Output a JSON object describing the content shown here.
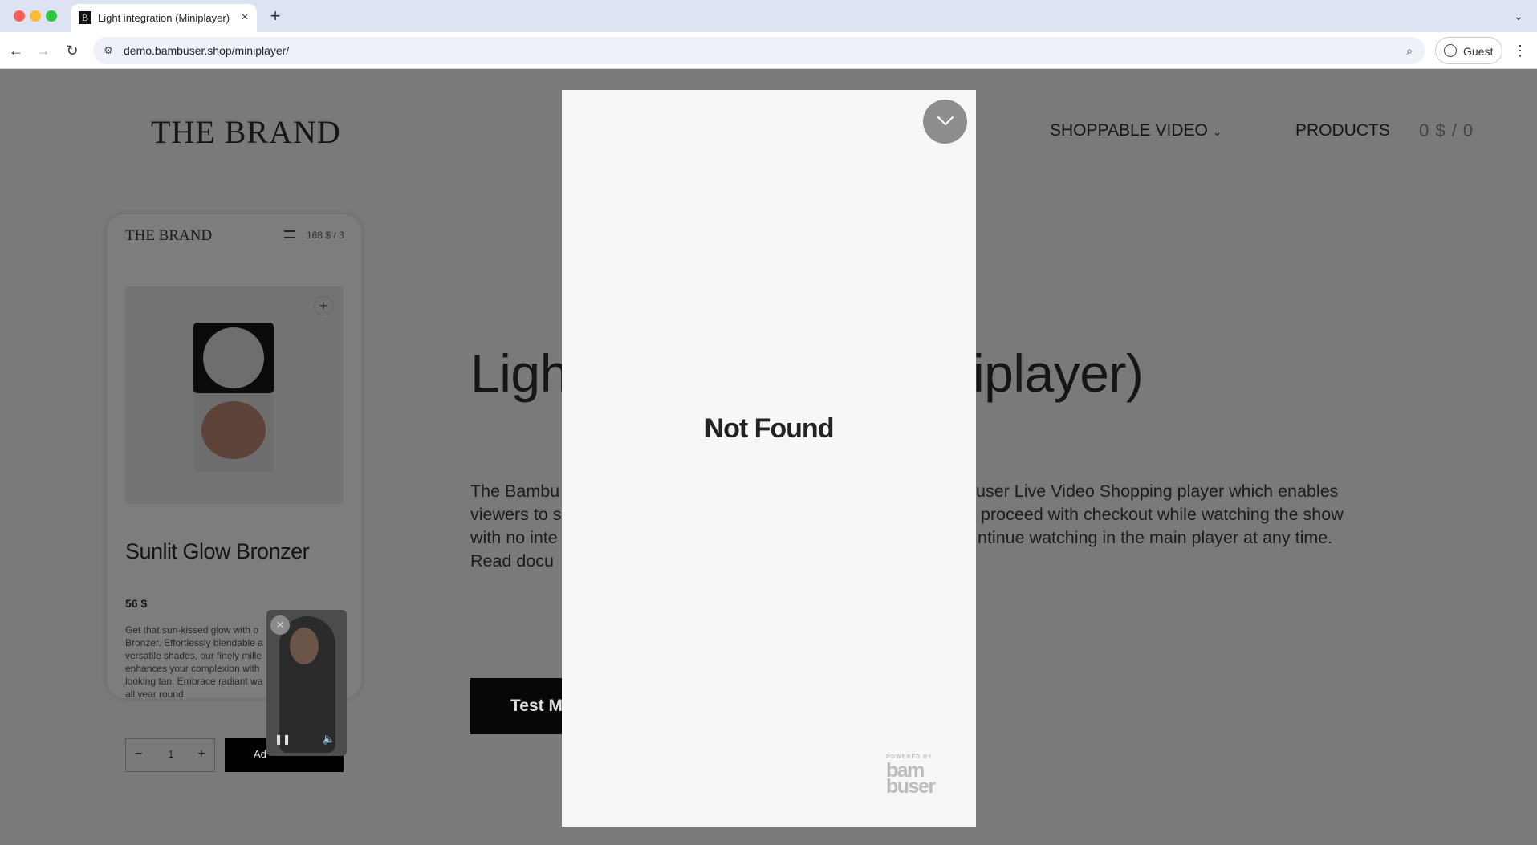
{
  "browser": {
    "tab_title": "Light integration (Miniplayer)",
    "tab_favicon": "B",
    "url": "demo.bambuser.shop/miniplayer/",
    "profile_label": "Guest"
  },
  "site": {
    "logo": "THE BRAND",
    "nav": {
      "shoppable": "SHOPPABLE VIDEO",
      "products": "PRODUCTS"
    },
    "cart": "0 $  / 0"
  },
  "phone": {
    "logo": "THE BRAND",
    "cart": "168 $ / 3",
    "product_name": "Sunlit Glow Bronzer",
    "price": "56 $",
    "description": "Get that sun-kissed glow with o Bronzer. Effortlessly blendable a versatile shades, our finely mille enhances your complexion with looking tan. Embrace radiant wa all year round.",
    "qty": "1",
    "add_label": "Ad"
  },
  "hero": {
    "title_left": "Ligh",
    "title_right": "iplayer)",
    "body_left": [
      "The Bambu",
      "viewers to s",
      "with no inte",
      "Read docu"
    ],
    "body_right": [
      "user Live Video Shopping player which enables",
      "proceed with checkout while watching the show",
      "ntinue watching in the main player at any time."
    ],
    "button_label": "Test M"
  },
  "modal": {
    "message": "Not Found",
    "powered_by": "POWERED BY",
    "powered_logo_line1": "bam",
    "powered_logo_line2": "buser"
  },
  "colors": {
    "overlay_dim": "#7a7a7a",
    "modal_bg": "#f7f7f7",
    "button_black": "#070707"
  }
}
